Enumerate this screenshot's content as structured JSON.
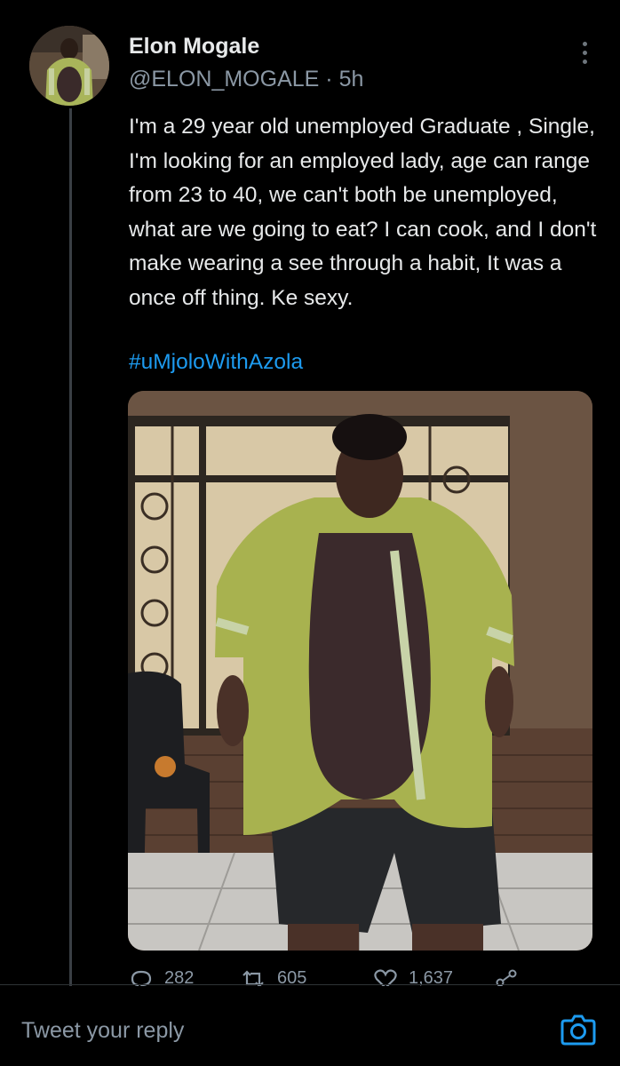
{
  "author": {
    "name": "Elon Mogale",
    "handle": "@ELON_MOGALE",
    "time": "5h",
    "meta_separator": " · "
  },
  "tweet": {
    "text": "I'm a 29 year old unemployed Graduate , Single, I'm looking for an employed lady, age can range from 23 to 40, we can't both be unemployed, what are we going to eat? I can cook, and I don't make wearing a see through a habit, It was a once off thing. Ke sexy.",
    "hashtag": "#uMjoloWithAzola"
  },
  "actions": {
    "replies": "282",
    "retweets": "605",
    "likes": "1,637"
  },
  "reply": {
    "placeholder": "Tweet your reply"
  },
  "icons": {
    "more": "more-vertical-icon",
    "reply": "reply-icon",
    "retweet": "retweet-icon",
    "like": "heart-icon",
    "share": "share-icon",
    "camera": "camera-icon"
  },
  "colors": {
    "background": "#000000",
    "text": "#e7e9ea",
    "secondary": "#8b98a5",
    "accent": "#1d9bf0"
  }
}
